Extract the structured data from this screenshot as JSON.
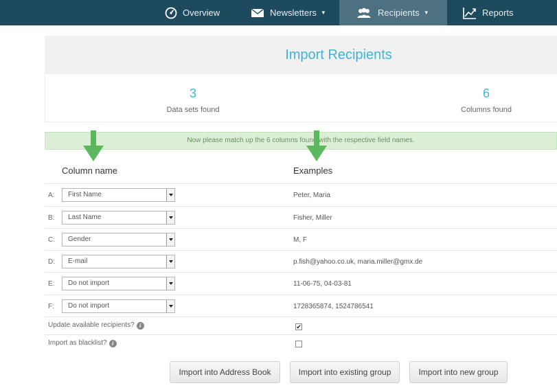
{
  "nav": {
    "items": [
      {
        "label": "Overview",
        "icon": "speedometer-icon",
        "dropdown": false
      },
      {
        "label": "Newsletters",
        "icon": "envelope-icon",
        "dropdown": true
      },
      {
        "label": "Recipients",
        "icon": "users-icon",
        "dropdown": true,
        "active": true
      },
      {
        "label": "Reports",
        "icon": "chart-icon",
        "dropdown": false
      }
    ],
    "caret": "▼"
  },
  "page": {
    "title": "Import Recipients",
    "stats": {
      "datasets_value": "3",
      "datasets_label": "Data sets found",
      "columns_value": "6",
      "columns_label": "Columns found"
    },
    "alert": "Now please match up the 6 columns found with the respective field names."
  },
  "table": {
    "headers": {
      "column_name": "Column name",
      "examples": "Examples"
    },
    "rows": [
      {
        "letter": "A:",
        "field": "First Name",
        "example": "Peter, Maria"
      },
      {
        "letter": "B:",
        "field": "Last Name",
        "example": "Fisher, Miller"
      },
      {
        "letter": "C:",
        "field": "Gender",
        "example": "M, F"
      },
      {
        "letter": "D:",
        "field": "E-mail",
        "example": "p.fish@yahoo.co.uk, maria.miller@gmx.de"
      },
      {
        "letter": "E:",
        "field": "Do not import",
        "example": "11-06-75, 04-03-81"
      },
      {
        "letter": "F:",
        "field": "Do not import",
        "example": "1728365874, 1524786541"
      }
    ]
  },
  "options": {
    "update_label": "Update available recipients?",
    "update_checked": true,
    "blacklist_label": "Import as blacklist?",
    "blacklist_checked": false,
    "info_glyph": "i",
    "check_glyph": "✔"
  },
  "buttons": {
    "address_book": "Import into Address Book",
    "existing_group": "Import into existing group",
    "new_group": "Import into new group"
  },
  "colors": {
    "nav_bg": "#1e4a5e",
    "nav_active": "#4d7180",
    "accent": "#3fb3d8",
    "alert_bg": "#dcefd6",
    "arrow": "#5cb85c"
  }
}
